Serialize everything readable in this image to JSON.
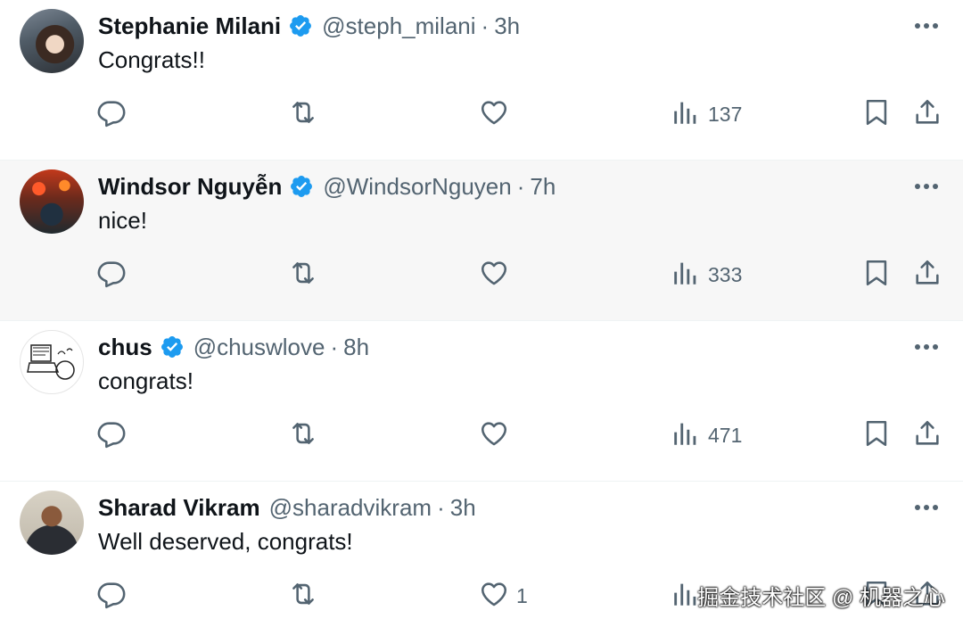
{
  "colors": {
    "verified": "#1d9bf0",
    "text": "#0f1419",
    "muted": "#536471"
  },
  "replies": [
    {
      "name": "Stephanie Milani",
      "verified": true,
      "handle": "@steph_milani",
      "separator": "·",
      "time": "3h",
      "text": "Congrats!!",
      "views": "137",
      "likes": ""
    },
    {
      "name": "Windsor Nguyễn",
      "verified": true,
      "handle": "@WindsorNguyen",
      "separator": "·",
      "time": "7h",
      "text": "nice!",
      "views": "333",
      "likes": ""
    },
    {
      "name": "chus",
      "verified": true,
      "handle": "@chuswlove",
      "separator": "·",
      "time": "8h",
      "text": "congrats!",
      "views": "471",
      "likes": ""
    },
    {
      "name": "Sharad Vikram",
      "verified": false,
      "handle": "@sharadvikram",
      "separator": "·",
      "time": "3h",
      "text": "Well deserved, congrats!",
      "views": "",
      "likes": "1"
    }
  ],
  "icons": [
    "reply-icon",
    "retweet-icon",
    "like-icon",
    "views-icon",
    "bookmark-icon",
    "share-icon",
    "more-icon",
    "verified-badge-icon"
  ],
  "watermark": "掘金技术社区 @ 机器之心"
}
